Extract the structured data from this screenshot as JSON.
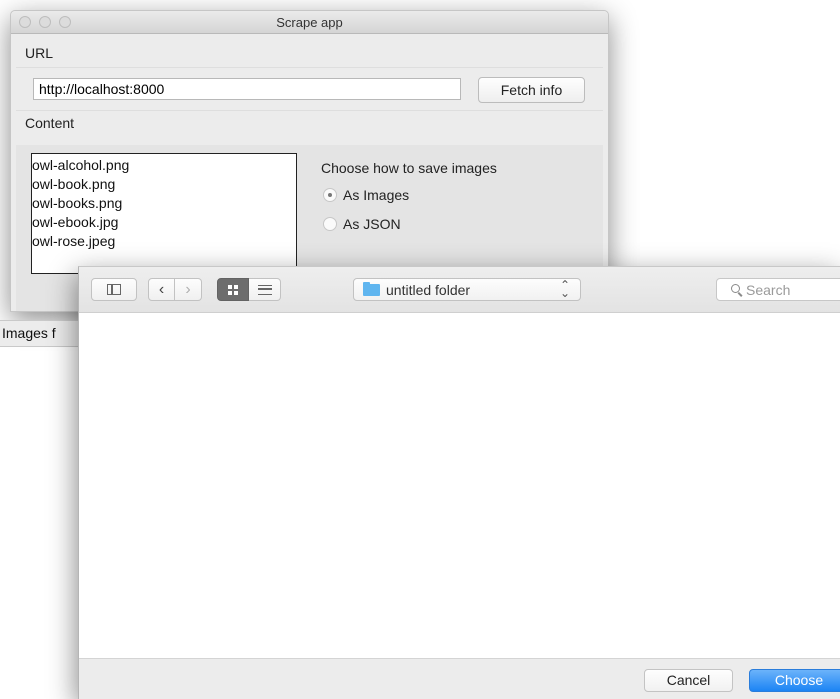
{
  "app_window": {
    "title": "Scrape app",
    "url_section_label": "URL",
    "url_value": "http://localhost:8000",
    "fetch_button_label": "Fetch info",
    "content_section_label": "Content",
    "files": [
      "owl-alcohol.png",
      "owl-book.png",
      "owl-books.png",
      "owl-ebook.jpg",
      "owl-rose.jpeg"
    ],
    "save_prompt": "Choose how to save images",
    "save_options": [
      {
        "label": "As Images",
        "selected": true
      },
      {
        "label": "As JSON",
        "selected": false
      }
    ],
    "status_text": "Images f"
  },
  "file_dialog": {
    "current_folder": "untitled folder",
    "search_placeholder": "Search",
    "view_mode": "icon",
    "cancel_label": "Cancel",
    "choose_label": "Choose",
    "colors": {
      "accent": "#1c84f4",
      "folder": "#5fb5ef"
    }
  }
}
